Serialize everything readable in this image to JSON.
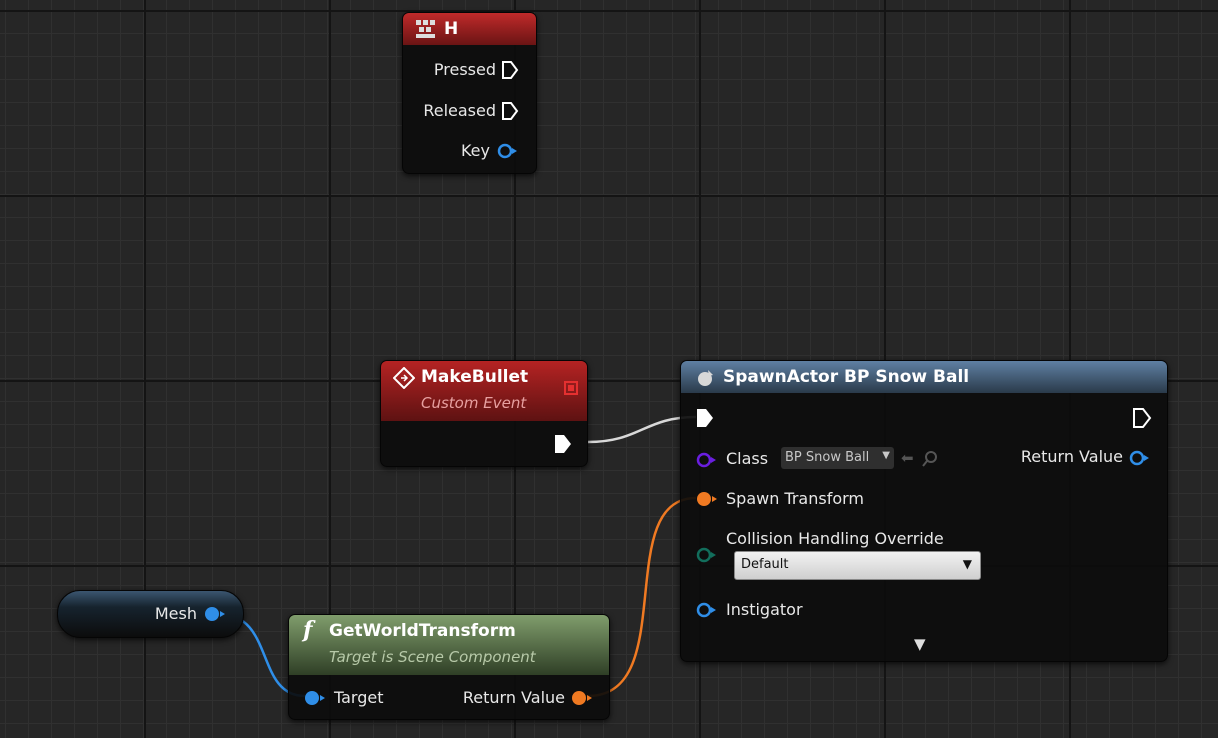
{
  "nodes": {
    "key_h": {
      "title": "H",
      "pins": {
        "pressed": "Pressed",
        "released": "Released",
        "key": "Key"
      }
    },
    "make_bullet": {
      "title": "MakeBullet",
      "subtitle": "Custom Event"
    },
    "spawn_actor": {
      "title": "SpawnActor BP Snow Ball",
      "pins": {
        "class": "Class",
        "class_value": "BP Snow Ball",
        "return_value": "Return Value",
        "spawn_transform": "Spawn Transform",
        "collision": "Collision Handling Override",
        "collision_value": "Default",
        "instigator": "Instigator"
      }
    },
    "mesh": {
      "label": "Mesh"
    },
    "get_world_transform": {
      "title": "GetWorldTransform",
      "subtitle": "Target is Scene Component",
      "pins": {
        "target": "Target",
        "return_value": "Return Value"
      }
    }
  },
  "colors": {
    "exec": "#ffffff",
    "object_pin": "#2f8ee8",
    "class_pin": "#6a1ee0",
    "transform_pin": "#f07a22",
    "enum_pin": "#126e5c",
    "event_header": "#9c1d1d",
    "function_header": "#6d8c5a",
    "spawn_header": "#4f6d8c"
  }
}
